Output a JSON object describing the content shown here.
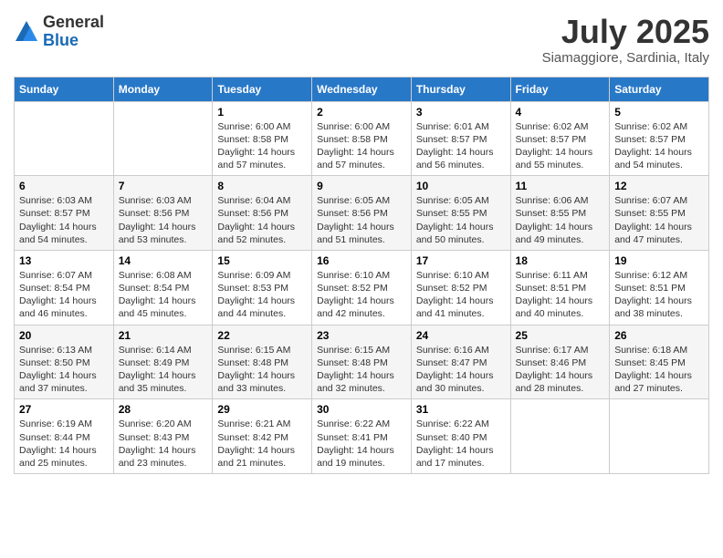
{
  "logo": {
    "general": "General",
    "blue": "Blue"
  },
  "title": "July 2025",
  "subtitle": "Siamaggiore, Sardinia, Italy",
  "days_of_week": [
    "Sunday",
    "Monday",
    "Tuesday",
    "Wednesday",
    "Thursday",
    "Friday",
    "Saturday"
  ],
  "weeks": [
    [
      {
        "day": "",
        "info": ""
      },
      {
        "day": "",
        "info": ""
      },
      {
        "day": "1",
        "info": "Sunrise: 6:00 AM\nSunset: 8:58 PM\nDaylight: 14 hours and 57 minutes."
      },
      {
        "day": "2",
        "info": "Sunrise: 6:00 AM\nSunset: 8:58 PM\nDaylight: 14 hours and 57 minutes."
      },
      {
        "day": "3",
        "info": "Sunrise: 6:01 AM\nSunset: 8:57 PM\nDaylight: 14 hours and 56 minutes."
      },
      {
        "day": "4",
        "info": "Sunrise: 6:02 AM\nSunset: 8:57 PM\nDaylight: 14 hours and 55 minutes."
      },
      {
        "day": "5",
        "info": "Sunrise: 6:02 AM\nSunset: 8:57 PM\nDaylight: 14 hours and 54 minutes."
      }
    ],
    [
      {
        "day": "6",
        "info": "Sunrise: 6:03 AM\nSunset: 8:57 PM\nDaylight: 14 hours and 54 minutes."
      },
      {
        "day": "7",
        "info": "Sunrise: 6:03 AM\nSunset: 8:56 PM\nDaylight: 14 hours and 53 minutes."
      },
      {
        "day": "8",
        "info": "Sunrise: 6:04 AM\nSunset: 8:56 PM\nDaylight: 14 hours and 52 minutes."
      },
      {
        "day": "9",
        "info": "Sunrise: 6:05 AM\nSunset: 8:56 PM\nDaylight: 14 hours and 51 minutes."
      },
      {
        "day": "10",
        "info": "Sunrise: 6:05 AM\nSunset: 8:55 PM\nDaylight: 14 hours and 50 minutes."
      },
      {
        "day": "11",
        "info": "Sunrise: 6:06 AM\nSunset: 8:55 PM\nDaylight: 14 hours and 49 minutes."
      },
      {
        "day": "12",
        "info": "Sunrise: 6:07 AM\nSunset: 8:55 PM\nDaylight: 14 hours and 47 minutes."
      }
    ],
    [
      {
        "day": "13",
        "info": "Sunrise: 6:07 AM\nSunset: 8:54 PM\nDaylight: 14 hours and 46 minutes."
      },
      {
        "day": "14",
        "info": "Sunrise: 6:08 AM\nSunset: 8:54 PM\nDaylight: 14 hours and 45 minutes."
      },
      {
        "day": "15",
        "info": "Sunrise: 6:09 AM\nSunset: 8:53 PM\nDaylight: 14 hours and 44 minutes."
      },
      {
        "day": "16",
        "info": "Sunrise: 6:10 AM\nSunset: 8:52 PM\nDaylight: 14 hours and 42 minutes."
      },
      {
        "day": "17",
        "info": "Sunrise: 6:10 AM\nSunset: 8:52 PM\nDaylight: 14 hours and 41 minutes."
      },
      {
        "day": "18",
        "info": "Sunrise: 6:11 AM\nSunset: 8:51 PM\nDaylight: 14 hours and 40 minutes."
      },
      {
        "day": "19",
        "info": "Sunrise: 6:12 AM\nSunset: 8:51 PM\nDaylight: 14 hours and 38 minutes."
      }
    ],
    [
      {
        "day": "20",
        "info": "Sunrise: 6:13 AM\nSunset: 8:50 PM\nDaylight: 14 hours and 37 minutes."
      },
      {
        "day": "21",
        "info": "Sunrise: 6:14 AM\nSunset: 8:49 PM\nDaylight: 14 hours and 35 minutes."
      },
      {
        "day": "22",
        "info": "Sunrise: 6:15 AM\nSunset: 8:48 PM\nDaylight: 14 hours and 33 minutes."
      },
      {
        "day": "23",
        "info": "Sunrise: 6:15 AM\nSunset: 8:48 PM\nDaylight: 14 hours and 32 minutes."
      },
      {
        "day": "24",
        "info": "Sunrise: 6:16 AM\nSunset: 8:47 PM\nDaylight: 14 hours and 30 minutes."
      },
      {
        "day": "25",
        "info": "Sunrise: 6:17 AM\nSunset: 8:46 PM\nDaylight: 14 hours and 28 minutes."
      },
      {
        "day": "26",
        "info": "Sunrise: 6:18 AM\nSunset: 8:45 PM\nDaylight: 14 hours and 27 minutes."
      }
    ],
    [
      {
        "day": "27",
        "info": "Sunrise: 6:19 AM\nSunset: 8:44 PM\nDaylight: 14 hours and 25 minutes."
      },
      {
        "day": "28",
        "info": "Sunrise: 6:20 AM\nSunset: 8:43 PM\nDaylight: 14 hours and 23 minutes."
      },
      {
        "day": "29",
        "info": "Sunrise: 6:21 AM\nSunset: 8:42 PM\nDaylight: 14 hours and 21 minutes."
      },
      {
        "day": "30",
        "info": "Sunrise: 6:22 AM\nSunset: 8:41 PM\nDaylight: 14 hours and 19 minutes."
      },
      {
        "day": "31",
        "info": "Sunrise: 6:22 AM\nSunset: 8:40 PM\nDaylight: 14 hours and 17 minutes."
      },
      {
        "day": "",
        "info": ""
      },
      {
        "day": "",
        "info": ""
      }
    ]
  ]
}
